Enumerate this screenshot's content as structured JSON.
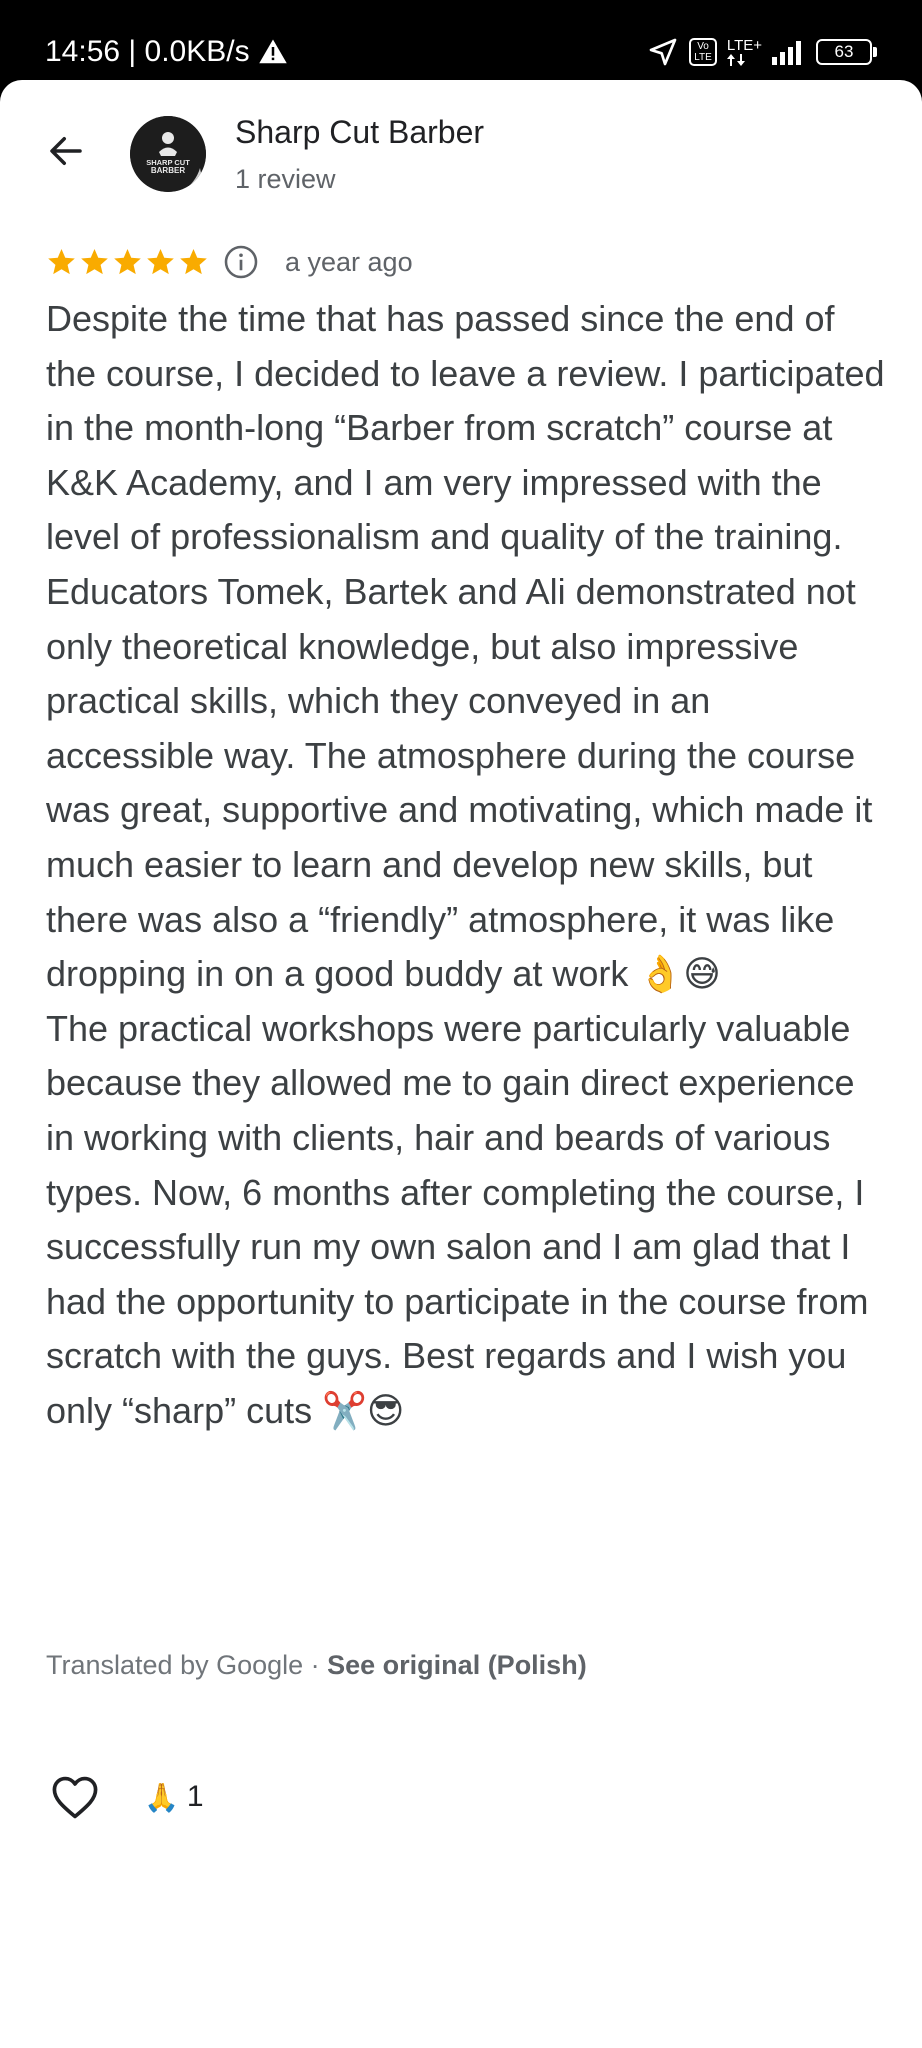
{
  "status_bar": {
    "time_speed": "14:56 | 0.0KB/s",
    "volte": "Vo\nLTE",
    "network": "LTE+",
    "battery": "63"
  },
  "header": {
    "author_name": "Sharp Cut Barber",
    "author_meta": "1 review",
    "avatar_text": "SHARP CUT BARBER"
  },
  "review": {
    "rating": 5,
    "date": "a year ago",
    "paragraph1": "Despite the time that has passed since the end of the course, I decided to leave a review. I participated in the month-long “Barber from scratch” course at K&K Academy, and I am very impressed with the level of professionalism and quality of the training. Educators Tomek, Bartek and Ali demonstrated not only theoretical knowledge, but also impressive practical skills, which they conveyed in an accessible way. The atmosphere during the course was great, supportive and motivating, which made it much easier to learn and develop new skills, but there was also a “friendly” atmosphere, it was like dropping in on a good buddy at work 👌😅",
    "paragraph2": "The practical workshops were particularly valuable because they allowed me to gain direct experience in working with clients, hair and beards of various types. Now, 6 months after completing the course, I successfully run my own salon and I am glad that I had the opportunity to participate in the course from scratch with the guys. Best regards and I wish you only “sharp” cuts ✂️😎"
  },
  "translation": {
    "label": "Translated by Google · ",
    "see_original": "See original (Polish)"
  },
  "actions": {
    "reaction_emoji": "🙏",
    "reaction_count": "1"
  },
  "colors": {
    "star": "#f9ab00",
    "text": "#3c4043",
    "secondary": "#5f6368"
  }
}
